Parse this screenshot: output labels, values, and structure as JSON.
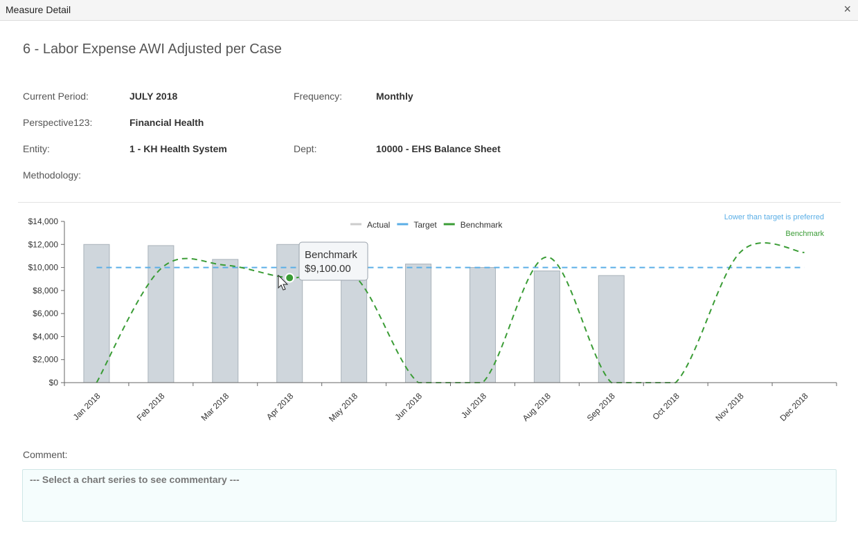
{
  "window": {
    "title": "Measure Detail",
    "close": "×"
  },
  "measure": {
    "title": "6 - Labor Expense AWI Adjusted per Case"
  },
  "details": {
    "current_period_label": "Current Period:",
    "current_period": "JULY 2018",
    "frequency_label": "Frequency:",
    "frequency": "Monthly",
    "perspective_label": "Perspective123:",
    "perspective": "Financial Health",
    "entity_label": "Entity:",
    "entity": "1 - KH Health System",
    "dept_label": "Dept:",
    "dept": "10000 - EHS Balance Sheet",
    "methodology_label": "Methodology:"
  },
  "chart_data": {
    "type": "bar",
    "categories": [
      "Jan 2018",
      "Feb 2018",
      "Mar 2018",
      "Apr 2018",
      "May 2018",
      "Jun 2018",
      "Jul 2018",
      "Aug 2018",
      "Sep 2018",
      "Oct 2018",
      "Nov 2018",
      "Dec 2018"
    ],
    "y_ticks": [
      "$0",
      "$2,000",
      "$4,000",
      "$6,000",
      "$8,000",
      "$10,000",
      "$12,000",
      "$14,000"
    ],
    "ylim": [
      0,
      14000
    ],
    "series": [
      {
        "name": "Actual",
        "type": "bar",
        "color": "#cfd6dc",
        "values": [
          12000,
          11900,
          10700,
          12000,
          9300,
          10300,
          10000,
          9700,
          9300,
          null,
          null,
          null
        ]
      },
      {
        "name": "Target",
        "type": "line",
        "style": "dashed",
        "color": "#5aaee6",
        "values": [
          10000,
          10000,
          10000,
          10000,
          10000,
          10000,
          10000,
          10000,
          10000,
          10000,
          10000,
          10000
        ]
      },
      {
        "name": "Benchmark",
        "type": "line",
        "style": "dashed-smooth",
        "color": "#3a9c35",
        "values": [
          0,
          9900,
          10200,
          9100,
          9300,
          0,
          0,
          10900,
          0,
          0,
          11300,
          11300
        ]
      }
    ],
    "annotations": {
      "preference": "Lower than target is preferred",
      "preference_series": "Benchmark"
    },
    "tooltip": {
      "series": "Benchmark",
      "value": "$9,100.00",
      "category": "Apr 2018"
    },
    "legend": "top-center"
  },
  "comment": {
    "label": "Comment:",
    "placeholder": "--- Select a chart series to see commentary ---"
  }
}
